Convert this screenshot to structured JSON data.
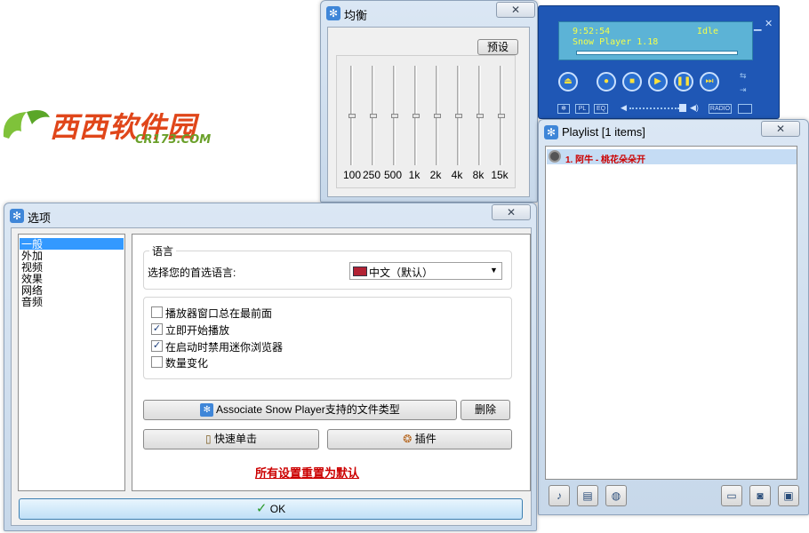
{
  "logo": {
    "text": "西西软件园",
    "sub": "CR173.COM"
  },
  "equalizer": {
    "title": "均衡",
    "preset_label": "预设",
    "bands": [
      "100",
      "250",
      "500",
      "1k",
      "2k",
      "4k",
      "8k",
      "15k"
    ]
  },
  "player": {
    "time": "9:52:54",
    "status": "Idle",
    "title": "Snow Player 1.18",
    "tags": [
      "PL",
      "EQ",
      "RADIO"
    ]
  },
  "playlist": {
    "title": "Playlist [1 items]",
    "items": [
      "1. 阿牛 - 桃花朵朵开"
    ]
  },
  "options": {
    "title": "选项",
    "categories": [
      "一般",
      "外加",
      "视频",
      "效果",
      "网络",
      "音频"
    ],
    "language_group": "语言",
    "language_prompt": "选择您的首选语言:",
    "language_value": "中文（默认）",
    "checkboxes": [
      {
        "label": "播放器窗口总在最前面",
        "checked": false
      },
      {
        "label": "立即开始播放",
        "checked": true
      },
      {
        "label": "在启动时禁用迷你浏览器",
        "checked": true
      },
      {
        "label": "数量变化",
        "checked": false
      }
    ],
    "associate_label": "Associate Snow Player支持的文件类型",
    "delete_label": "删除",
    "quick_click_label": "快速单击",
    "plugins_label": "插件",
    "reset_link": "所有设置重置为默认",
    "ok_label": "OK",
    "check_mark": "✓"
  },
  "colors": {
    "accent": "#1f57b5",
    "reset_link": "#cc0000",
    "ok_check": "#2a9a2a"
  }
}
